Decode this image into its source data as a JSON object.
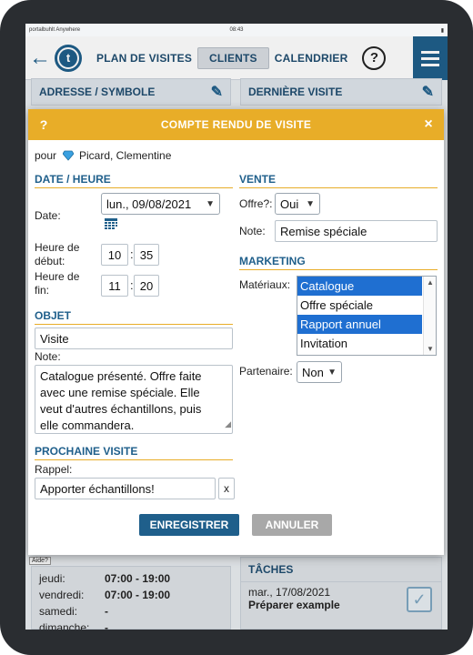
{
  "status_bar": {
    "left": "portalbuhlt Anywhere",
    "time": "08:43",
    "right": ""
  },
  "nav": {
    "plan": "PLAN DE VISITES",
    "clients": "CLIENTS",
    "calendar": "CALENDRIER",
    "help": "?"
  },
  "background": {
    "address_header": "ADRESSE / SYMBOLE",
    "last_visit_header": "DERNIÈRE VISITE",
    "tooltip": "Aide?",
    "schedule": [
      {
        "day": "jeudi:",
        "hours": "07:00 - 19:00"
      },
      {
        "day": "vendredi:",
        "hours": "07:00 - 19:00"
      },
      {
        "day": "samedi:",
        "hours": "-"
      },
      {
        "day": "dimanche:",
        "hours": "-"
      }
    ],
    "tasks_title": "TÂCHES",
    "task_date": "mar., 17/08/2021",
    "task_name": "Préparer example"
  },
  "dialog": {
    "help": "?",
    "title": "COMPTE RENDU DE VISITE",
    "close": "×",
    "for_label": "pour",
    "client_name": "Picard, Clementine",
    "date_section": "DATE / HEURE",
    "date_label": "Date:",
    "date_value": "lun., 09/08/2021",
    "start_label_1": "Heure de",
    "start_label_2": "début:",
    "start_hour": "10",
    "start_min": "35",
    "end_label_1": "Heure de",
    "end_label_2": "fin:",
    "end_hour": "11",
    "end_min": "20",
    "time_sep": ":",
    "object_section": "OBJET",
    "object_value": "Visite",
    "note_label": "Note:",
    "note_lines": [
      "Catalogue présenté. Offre faite",
      "avec une remise spéciale. Elle",
      "veut d'autres échantillons, puis",
      "elle commandera."
    ],
    "next_visit_section": "PROCHAINE VISITE",
    "reminder_label": "Rappel:",
    "reminder_value": "Apporter échantillons!",
    "clear_label": "x",
    "sale_section": "VENTE",
    "offer_label": "Offre?:",
    "offer_value": "Oui",
    "sale_note_label": "Note:",
    "sale_note_value": "Remise spéciale",
    "marketing_section": "MARKETING",
    "materials_label": "Matériaux:",
    "materials": [
      {
        "label": "Catalogue",
        "selected": true
      },
      {
        "label": "Offre spéciale",
        "selected": false
      },
      {
        "label": "Rapport annuel",
        "selected": true
      },
      {
        "label": "Invitation",
        "selected": false
      }
    ],
    "partner_label": "Partenaire:",
    "partner_value": "Non",
    "save_label": "ENREGISTRER",
    "cancel_label": "ANNULER"
  },
  "colors": {
    "primary": "#1f5f8b",
    "accent": "#e8ad28",
    "selection": "#1f6fd1"
  }
}
